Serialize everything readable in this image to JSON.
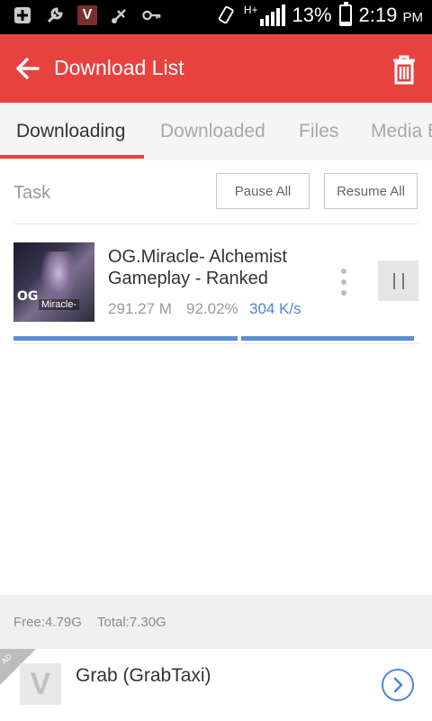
{
  "status_bar": {
    "network": "H+",
    "battery_percent": "13%",
    "battery_level": 0.13,
    "time": "2:19",
    "ampm": "PM",
    "icons": [
      "add-icon",
      "wrench-icon",
      "vbox-icon",
      "usb-icon",
      "key-icon",
      "rotate-icon",
      "signal-icon",
      "battery-icon"
    ]
  },
  "app_bar": {
    "title": "Download List",
    "background": "#e84240"
  },
  "tabs": [
    {
      "label": "Downloading",
      "active": true
    },
    {
      "label": "Downloaded",
      "active": false
    },
    {
      "label": "Files",
      "active": false
    },
    {
      "label": "Media Explorer",
      "active": false
    }
  ],
  "toolbar": {
    "task_label": "Task",
    "pause_all": "Pause All",
    "resume_all": "Resume All"
  },
  "downloads": [
    {
      "title": "OG.Miracle- Alchemist Gameplay - Ranked",
      "size": "291.27 M",
      "percent": "92.02%",
      "speed": "304 K/s",
      "thumb_logo": "OG",
      "thumb_caption": "Miracle-"
    }
  ],
  "storage": {
    "free": "Free:4.79G",
    "total": "Total:7.30G"
  },
  "ad": {
    "corner_label": "AD",
    "icon_letter": "V",
    "title": "Grab (GrabTaxi)"
  },
  "colors": {
    "accent": "#e84240",
    "progress": "#5b8fd6",
    "speed": "#4a86d8"
  }
}
